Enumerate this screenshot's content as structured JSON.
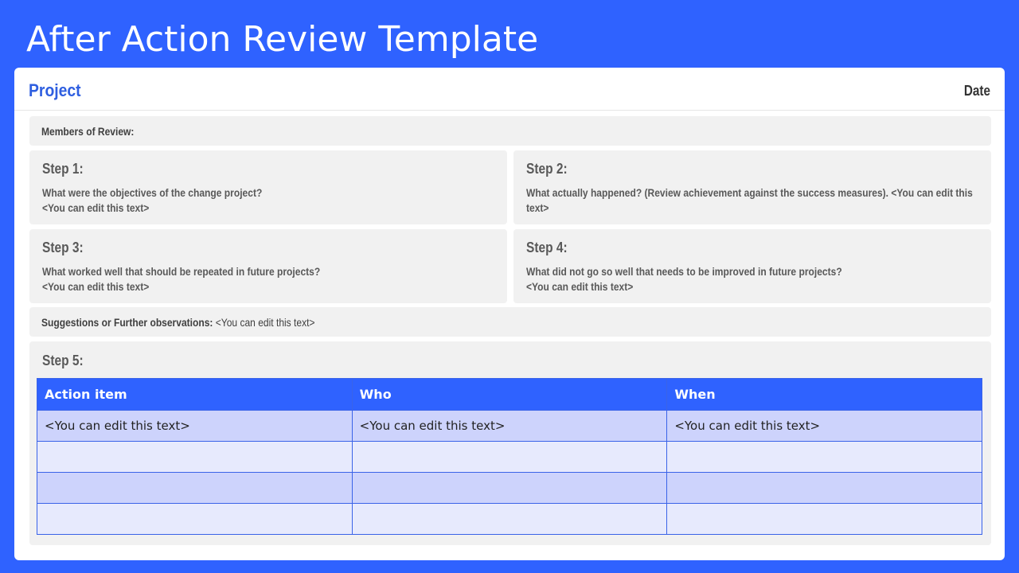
{
  "slide": {
    "title": "After Action Review Template"
  },
  "header": {
    "project_label": "Project",
    "date_label": "Date"
  },
  "members": {
    "label": "Members of Review:"
  },
  "steps": [
    {
      "heading": "Step 1:",
      "question": "What were the objectives of the change project?",
      "placeholder": "<You can edit this text>"
    },
    {
      "heading": "Step 2:",
      "question": "What actually happened?  (Review achievement against the success measures).  <You can edit this text>",
      "placeholder": ""
    },
    {
      "heading": "Step 3:",
      "question": "What worked well that should be repeated in future projects?",
      "placeholder": "<You can edit this text>"
    },
    {
      "heading": "Step 4:",
      "question": "What did not go so well that needs to be improved in future projects?",
      "placeholder": "<You can edit this text>"
    }
  ],
  "suggestions": {
    "label": "Suggestions or Further observations:",
    "placeholder": "<You can edit this text>"
  },
  "step5": {
    "heading": "Step 5:",
    "columns": [
      "Action item",
      "Who",
      "When"
    ],
    "rows": [
      [
        "<You can edit this text>",
        "<You can edit this text>",
        "<You can edit this text>"
      ],
      [
        "",
        "",
        ""
      ],
      [
        "",
        "",
        ""
      ],
      [
        "",
        "",
        ""
      ]
    ]
  },
  "colors": {
    "background": "#2f62ff",
    "accent": "#2f5fe0",
    "row_odd": "#cdd3fc",
    "row_even": "#e7eafd"
  }
}
